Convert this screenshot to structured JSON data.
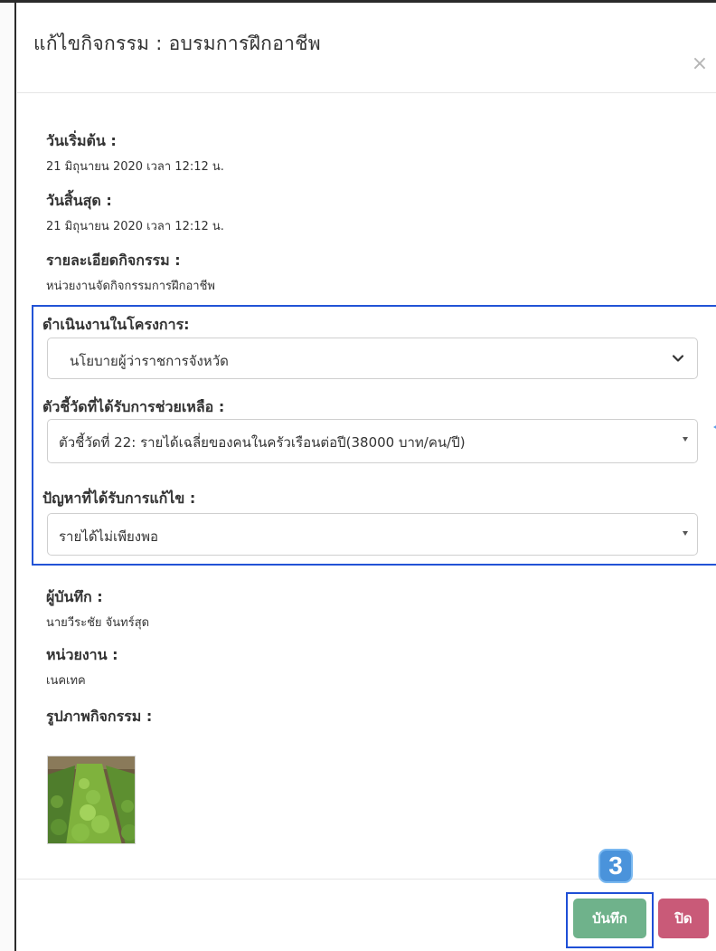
{
  "modal": {
    "title": "แก้ไขกิจกรรม : อบรมการฝึกอาชีพ",
    "close_symbol": "×"
  },
  "fields": {
    "start_label": "วันเริ่มต้น :",
    "start_value": "21 มิถุนายน 2020 เวลา 12:12 น.",
    "end_label": "วันสิ้นสุด :",
    "end_value": "21 มิถุนายน 2020 เวลา 12:12 น.",
    "detail_label": "รายละเอียดกิจกรรม :",
    "detail_value": "หน่วยงานจัดกิจกรรมการฝึกอาชีพ",
    "recorder_label": "ผู้บันทึก :",
    "recorder_value": "นายวีระชัย จันทร์สุด",
    "agency_label": "หน่วยงาน :",
    "agency_value": "เนคเทค",
    "photo_label": "รูปภาพกิจกรรม :"
  },
  "form": {
    "project_label": "ดำเนินงานในโครงการ:",
    "project_value": "นโยบายผู้ว่าราชการจังหวัด",
    "indicator_label": "ตัวชี้วัดที่ได้รับการช่วยเหลือ :",
    "indicator_value": "ตัวชี้วัดที่ 22: รายได้เฉลี่ยของคนในครัวเรือนต่อปี(38000 บาท/คน/ปี)",
    "problem_label": "ปัญหาที่ได้รับการแก้ไข :",
    "problem_value": "รายได้ไม่เพียงพอ"
  },
  "footer": {
    "step_number": "3",
    "save_label": "บันทึก",
    "close_label": "ปิด"
  },
  "colors": {
    "highlight_border": "#2253d6",
    "save_button": "#6fb28b",
    "close_button": "#c95a78",
    "step_badge": "#4a93db"
  },
  "icons": {
    "close": "close-icon",
    "project_dropdown": "chevron-down-icon",
    "indicator_dropdown": "caret-down-icon",
    "problem_dropdown": "caret-down-icon"
  }
}
